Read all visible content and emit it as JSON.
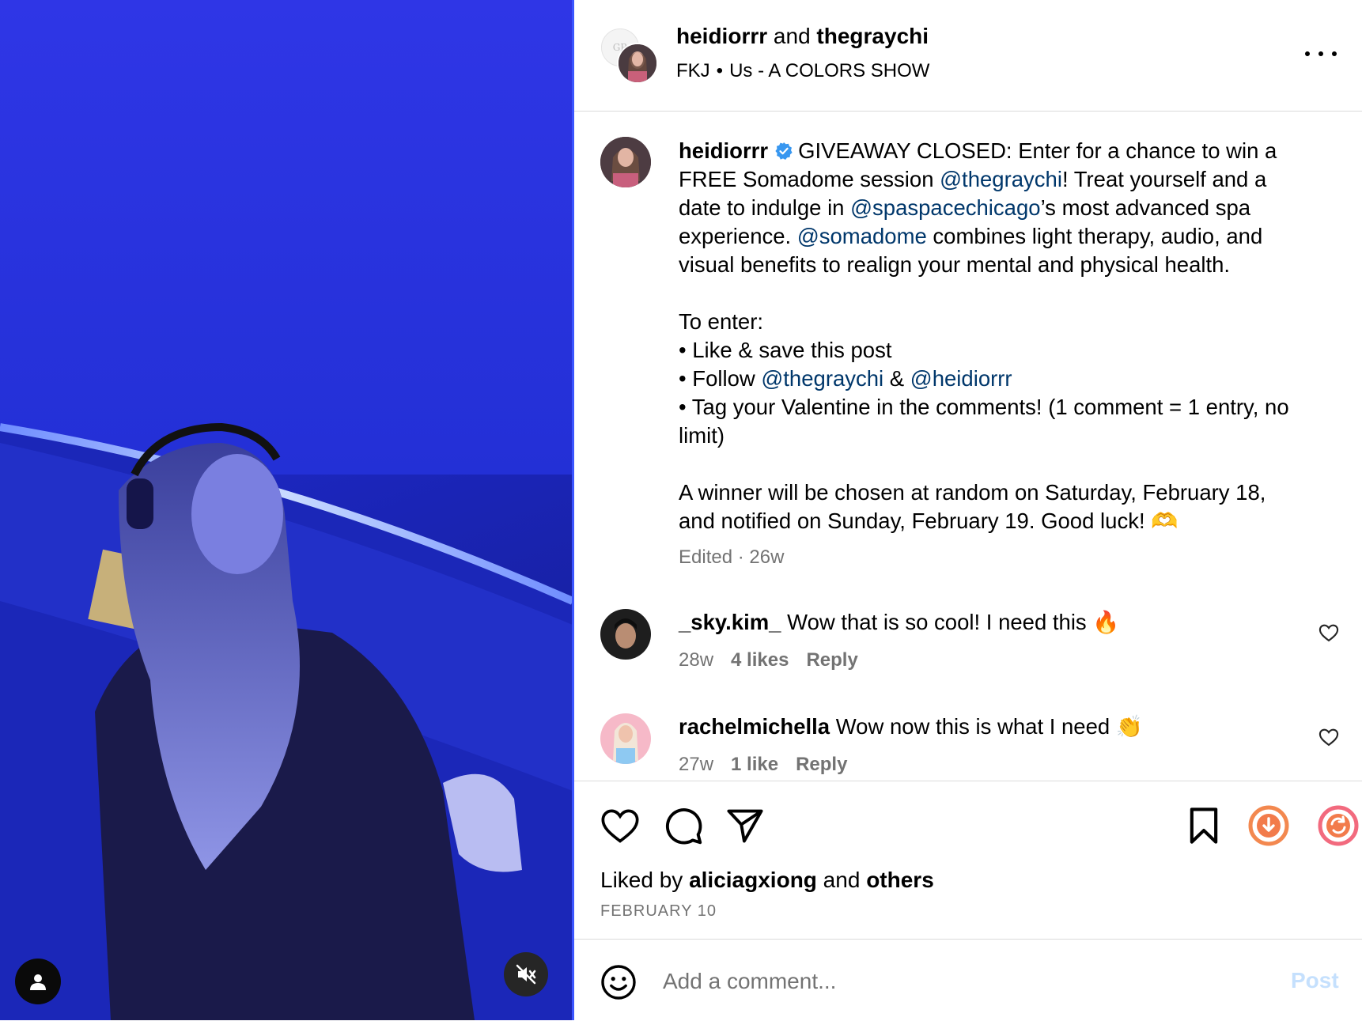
{
  "media": {
    "tag_button_icon": "user-tag-icon",
    "mute_button_icon": "muted-speaker-icon",
    "accent_colors": [
      "#2a2fe0",
      "#121a7d",
      "#3b55ff"
    ]
  },
  "header": {
    "author1": "heidiorrr",
    "joiner": " and ",
    "author2": "thegraychi",
    "audio_artist": "FKJ",
    "audio_sep": "•",
    "audio_track": "Us - A COLORS SHOW",
    "collab_avatar_letters": "GR"
  },
  "caption": {
    "username": "heidiorrr",
    "p1_a": "GIVEAWAY CLOSED: Enter for a chance to win a FREE Somadome session ",
    "mention1": "@thegraychi",
    "p1_b": "! Treat yourself and a date to indulge in ",
    "mention2": "@spaspacechicago",
    "p1_c": "’s most advanced spa experience. ",
    "mention3": "@somadome",
    "p1_d": " combines light therapy, audio, and visual benefits to realign your mental and physical health.",
    "to_enter": "To enter:",
    "bullet1": "• Like & save this post",
    "bullet2_a": "• Follow ",
    "mention4": "@thegraychi",
    "bullet2_b": " & ",
    "mention5": "@heidiorrr",
    "bullet3": "• Tag your Valentine in the comments! (1 comment = 1 entry, no limit)",
    "closing": "A winner will be chosen at random on Saturday, February 18, and notified on Sunday, February 19. Good luck! 🫶",
    "edited": "Edited · 26w"
  },
  "comments": [
    {
      "username": "_sky.kim_",
      "text": "Wow that is so cool! I need this 🔥",
      "time": "28w",
      "likes": "4 likes",
      "reply": "Reply"
    },
    {
      "username": "rachelmichella",
      "text": "Wow now this is what I need 👏",
      "time": "27w",
      "likes": "1 like",
      "reply": "Reply"
    }
  ],
  "actions": {
    "liked_by_prefix": "Liked by ",
    "liked_by_user": "aliciagxiong",
    "liked_by_mid": " and ",
    "liked_by_others": "others",
    "date": "FEBRUARY 10"
  },
  "comment_box": {
    "placeholder": "Add a comment...",
    "post_label": "Post"
  }
}
